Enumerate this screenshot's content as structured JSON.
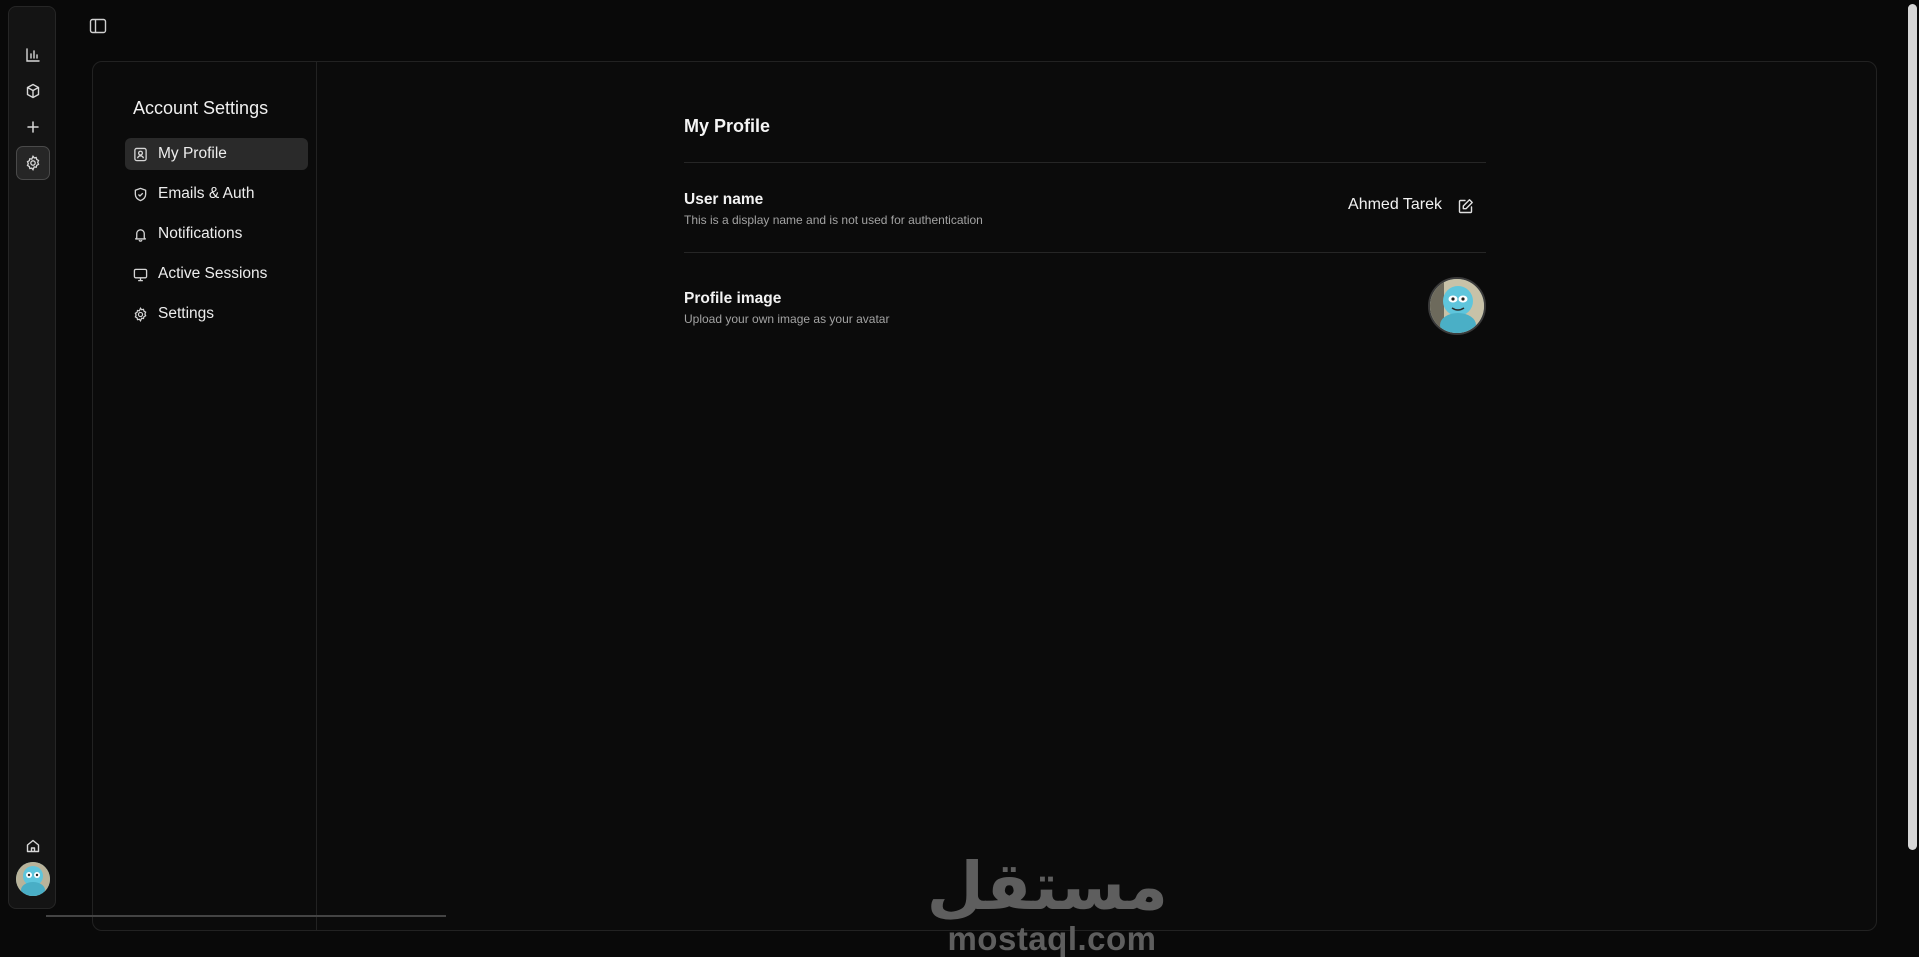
{
  "rail": {
    "items": [
      {
        "name": "analytics-icon"
      },
      {
        "name": "package-icon"
      },
      {
        "name": "plus-icon"
      },
      {
        "name": "gear-icon",
        "active": true
      }
    ],
    "bottom": [
      {
        "name": "home-icon"
      }
    ]
  },
  "nav": {
    "title": "Account Settings",
    "items": [
      {
        "label": "My Profile",
        "icon": "profile-icon",
        "active": true
      },
      {
        "label": "Emails & Auth",
        "icon": "shield-icon"
      },
      {
        "label": "Notifications",
        "icon": "bell-icon"
      },
      {
        "label": "Active Sessions",
        "icon": "monitor-icon"
      },
      {
        "label": "Settings",
        "icon": "gear-icon"
      }
    ]
  },
  "profile": {
    "title": "My Profile",
    "username_title": "User name",
    "username_desc": "This is a display name and is not used for authentication",
    "username_value": "Ahmed Tarek",
    "image_title": "Profile image",
    "image_desc": "Upload your own image as your avatar"
  },
  "watermark": {
    "arabic": "مستقل",
    "latin": "mostaql.com"
  },
  "colors": {
    "background": "#090909",
    "panel": "#0b0b0b",
    "active_item": "#2a2a2a",
    "muted_text": "#a3a3a3"
  }
}
